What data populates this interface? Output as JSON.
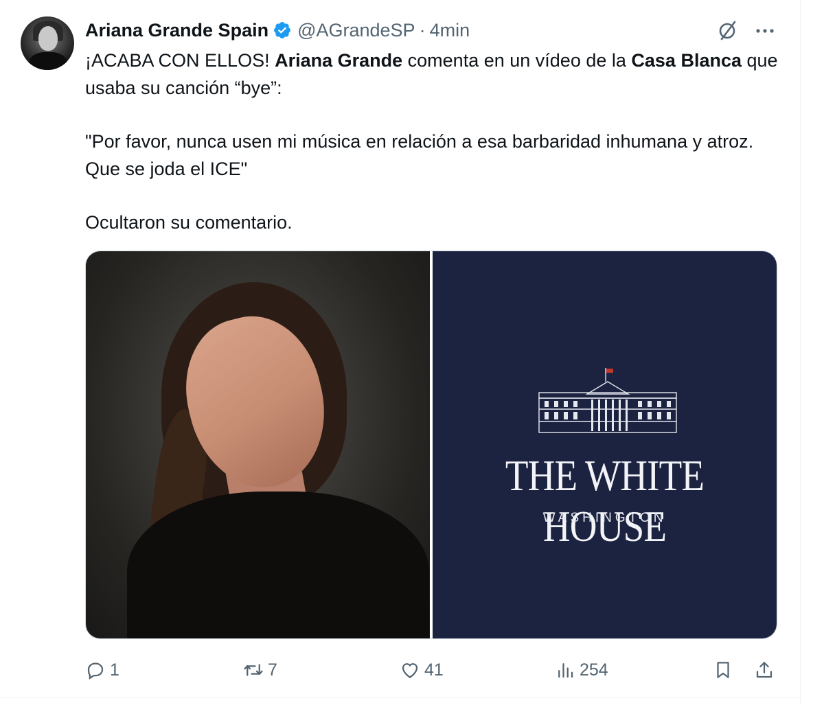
{
  "tweet": {
    "author_name": "Ariana Grande Spain",
    "handle": "@AGrandeSP",
    "separator": "·",
    "time": "4min",
    "text": {
      "p1_a": "¡ACABA CON ELLOS! ",
      "p1_b": "Ariana Grande",
      "p1_c": " comenta en un vídeo de la ",
      "p1_d": "Casa Blanca",
      "p1_e": " que usaba su canción “bye”:",
      "p2": "\"Por favor, nunca usen mi música en relación a esa barbaridad inhumana y atroz. Que se joda el ICE\"",
      "p3": "Ocultaron su comentario."
    },
    "media": {
      "left_image": "photo-portrait",
      "right_image": {
        "title": "THE WHITE HOUSE",
        "subtitle": "WASHINGTON"
      }
    },
    "actions": {
      "reply_count": "1",
      "retweet_count": "7",
      "like_count": "41",
      "views_count": "254"
    }
  },
  "colors": {
    "verified": "#1d9bf0",
    "secondary_text": "#536471",
    "white_house_bg": "#1c2340"
  },
  "icons": [
    "verified-badge-icon",
    "grok-icon",
    "more-icon",
    "reply-icon",
    "retweet-icon",
    "like-icon",
    "views-icon",
    "bookmark-icon",
    "share-icon"
  ]
}
